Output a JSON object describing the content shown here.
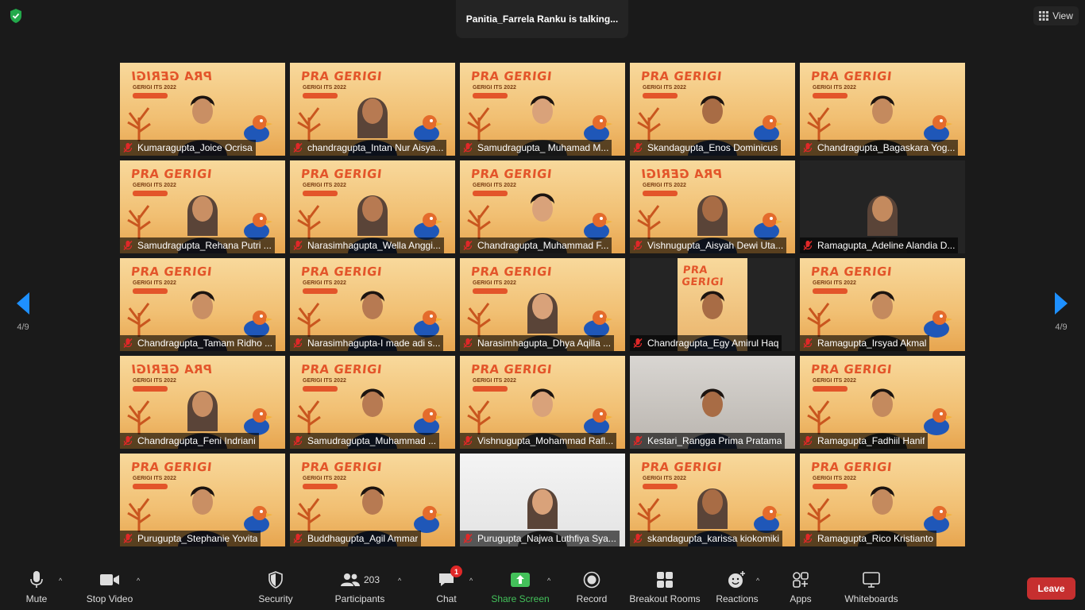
{
  "talking_banner": "Panitia_Farrela Ranku is talking...",
  "view_button": "View",
  "page_indicator": "4/9",
  "background": {
    "title": "PRA GERIGI",
    "subtitle": "GERIGI ITS 2022",
    "tag": "PESERTA"
  },
  "participants": [
    {
      "name": "Kumaragupta_Joice Ocrisa",
      "mirror": true
    },
    {
      "name": "chandragupta_Intan Nur Aisya..."
    },
    {
      "name": "Samudragupta_ Muhamad M..."
    },
    {
      "name": "Skandagupta_Enos Dominicus"
    },
    {
      "name": "Chandragupta_Bagaskara Yog..."
    },
    {
      "name": "Samudragupta_Rehana Putri ..."
    },
    {
      "name": "Narasimhagupta_Wella Anggi..."
    },
    {
      "name": "Chandragupta_Muhammad F..."
    },
    {
      "name": "Vishnugupta_Aisyah Dewi Uta...",
      "mirror": true
    },
    {
      "name": "Ramagupta_Adeline Alandia D...",
      "bg": "dark"
    },
    {
      "name": "Chandragupta_Tamam Ridho ..."
    },
    {
      "name": "Narasimhagupta-I made adi s..."
    },
    {
      "name": "Narasimhagupta_Dhya Aqilla ..."
    },
    {
      "name": "Chandragupta_Egy Amirul Haq",
      "bg": "inset"
    },
    {
      "name": "Ramagupta_Irsyad Akmal"
    },
    {
      "name": "Chandragupta_Feni Indriani",
      "mirror": true
    },
    {
      "name": "Samudragupta_Muhammad ..."
    },
    {
      "name": "Vishnugupta_Mohammad Rafl..."
    },
    {
      "name": "Kestari_Rangga Prima Pratama",
      "bg": "grey"
    },
    {
      "name": "Ramagupta_Fadhiil Hanif"
    },
    {
      "name": "Purugupta_Stephanie Yovita"
    },
    {
      "name": "Buddhagupta_Agil Ammar"
    },
    {
      "name": "Purugupta_Najwa Luthfiya Sya...",
      "bg": "white"
    },
    {
      "name": "skandagupta_karissa kiokomiki"
    },
    {
      "name": "Ramagupta_Rico Kristianto"
    }
  ],
  "toolbar": {
    "mute": "Mute",
    "stop_video": "Stop Video",
    "security": "Security",
    "participants": "Participants",
    "participants_count": "203",
    "chat": "Chat",
    "chat_badge": "1",
    "share_screen": "Share Screen",
    "record": "Record",
    "breakout_rooms": "Breakout Rooms",
    "reactions": "Reactions",
    "apps": "Apps",
    "whiteboards": "Whiteboards",
    "leave": "Leave"
  },
  "colors": {
    "accent_green": "#43c15a",
    "leave_red": "#c62f2f",
    "muted_red": "#e02828",
    "background": "#1a1a1a"
  }
}
